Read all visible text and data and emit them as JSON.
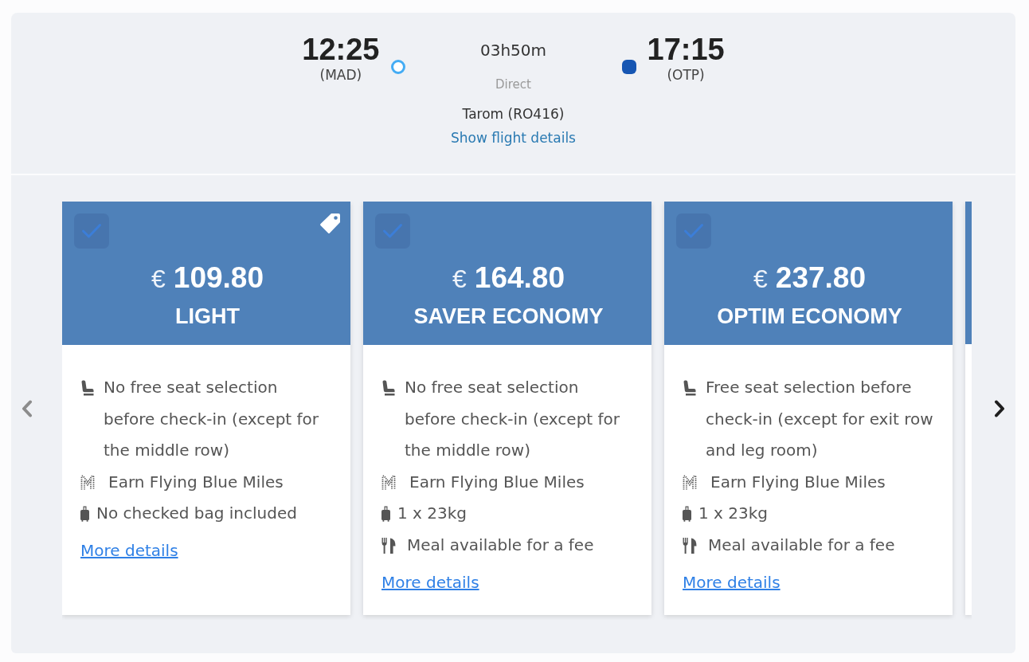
{
  "flight": {
    "departure": {
      "time": "12:25",
      "airport": "(MAD)"
    },
    "arrival": {
      "time": "17:15",
      "airport": "(OTP)"
    },
    "duration": "03h50m",
    "stops": "Direct",
    "carrier": "Tarom (RO416)",
    "details_link": "Show flight details"
  },
  "nav": {
    "previous": {
      "disabled": true
    },
    "next": {
      "disabled": false
    }
  },
  "fares": [
    {
      "selected": false,
      "price_tag": true,
      "currency": "€",
      "price": "109.80",
      "name": "LIGHT",
      "features": [
        {
          "kind": "seat",
          "text": "No free seat selection before check-in (except for the middle row)"
        },
        {
          "kind": "miles",
          "text": "Earn Flying Blue Miles"
        },
        {
          "kind": "bag",
          "text": "No checked bag included"
        }
      ],
      "link": "More details"
    },
    {
      "selected": false,
      "price_tag": false,
      "currency": "€",
      "price": "164.80",
      "name": "SAVER ECONOMY",
      "features": [
        {
          "kind": "seat",
          "text": "No free seat selection before check-in (except for the middle row)"
        },
        {
          "kind": "miles",
          "text": "Earn Flying Blue Miles"
        },
        {
          "kind": "bag",
          "text": "1 x 23kg"
        },
        {
          "kind": "meal",
          "text": "Meal available for a fee"
        }
      ],
      "link": "More details"
    },
    {
      "selected": false,
      "price_tag": false,
      "currency": "€",
      "price": "237.80",
      "name": "OPTIM ECONOMY",
      "features": [
        {
          "kind": "seat",
          "text": "Free seat selection before check-in (except for exit row and leg room)"
        },
        {
          "kind": "miles",
          "text": "Earn Flying Blue Miles"
        },
        {
          "kind": "bag",
          "text": "1 x 23kg"
        },
        {
          "kind": "meal",
          "text": "Meal available for a fee"
        }
      ],
      "link": "More details"
    }
  ]
}
